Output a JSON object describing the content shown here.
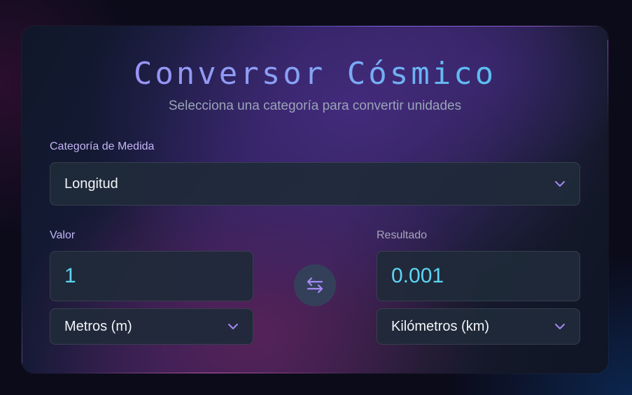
{
  "header": {
    "title": "Conversor Cósmico",
    "subtitle": "Selecciona una categoría para convertir unidades"
  },
  "category": {
    "label": "Categoría de Medida",
    "selected": "Longitud"
  },
  "from": {
    "label": "Valor",
    "value": "1",
    "unit": "Metros (m)"
  },
  "to": {
    "label": "Resultado",
    "value": "0.001",
    "unit": "Kilómetros (km)"
  },
  "icons": {
    "swap": "swap-arrows-icon",
    "chevron": "chevron-down-icon"
  },
  "colors": {
    "accent": "#a48af6",
    "value_text": "#5dd6f2",
    "title_start": "#a38bf5",
    "title_end": "#3fd0f0"
  }
}
